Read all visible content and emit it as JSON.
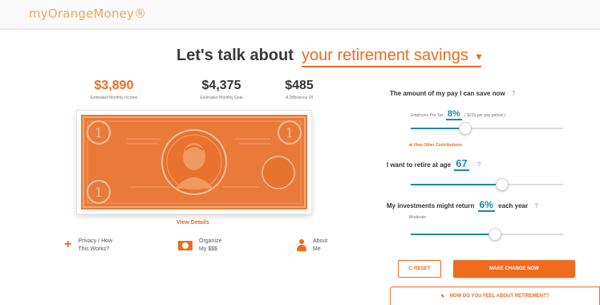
{
  "header": {
    "logo_text": "myOrangeMoney®",
    "logo_tagline": "...."
  },
  "headline": {
    "lead": "Let's talk about",
    "topic": "your retirement savings",
    "caret": "▾"
  },
  "stats": [
    {
      "value": "$3,890",
      "label": "Estimated Monthly Income",
      "color": "#ef6b1f"
    },
    {
      "value": "$4,375",
      "label": "Estimated Monthly Goal",
      "color": "#333333"
    },
    {
      "value": "$485",
      "label": "A Difference Of",
      "color": "#333333"
    }
  ],
  "view_details": "View Details",
  "bottom_links": [
    {
      "icon": "plus-icon",
      "line1": "Privacy / How",
      "line2": "This Works?"
    },
    {
      "icon": "money-icon",
      "line1": "Organize",
      "line2": "My $$$"
    },
    {
      "icon": "person-icon",
      "line1": "About",
      "line2": "Me"
    }
  ],
  "savings": {
    "title": "The amount of my pay I can save now",
    "help": "?",
    "sub_prefix": "Employee Pre Tax",
    "percent": "8%",
    "sub_suffix": "( $233 per pay period )",
    "level": 0.36,
    "other_link": "View Other Contributions",
    "other_marker": "⊕"
  },
  "retire": {
    "title": "I want to retire at age",
    "age": "67",
    "help": "?",
    "level": 0.6
  },
  "returns": {
    "title_prefix": "My investments might return",
    "percent": "6%",
    "title_suffix": "each year",
    "help": "?",
    "sub": "Moderate",
    "level": 0.55
  },
  "buttons": {
    "reset_icon": "C",
    "reset": "RESET",
    "make_change": "MAKE CHANGE NOW",
    "feel_icon": "✎",
    "feel": "HOW DO YOU FEEL ABOUT RETIREMENT?"
  },
  "colors": {
    "accent": "#ef6b1f",
    "teal": "#1a8aa8",
    "bill": "#ea7a3a"
  }
}
